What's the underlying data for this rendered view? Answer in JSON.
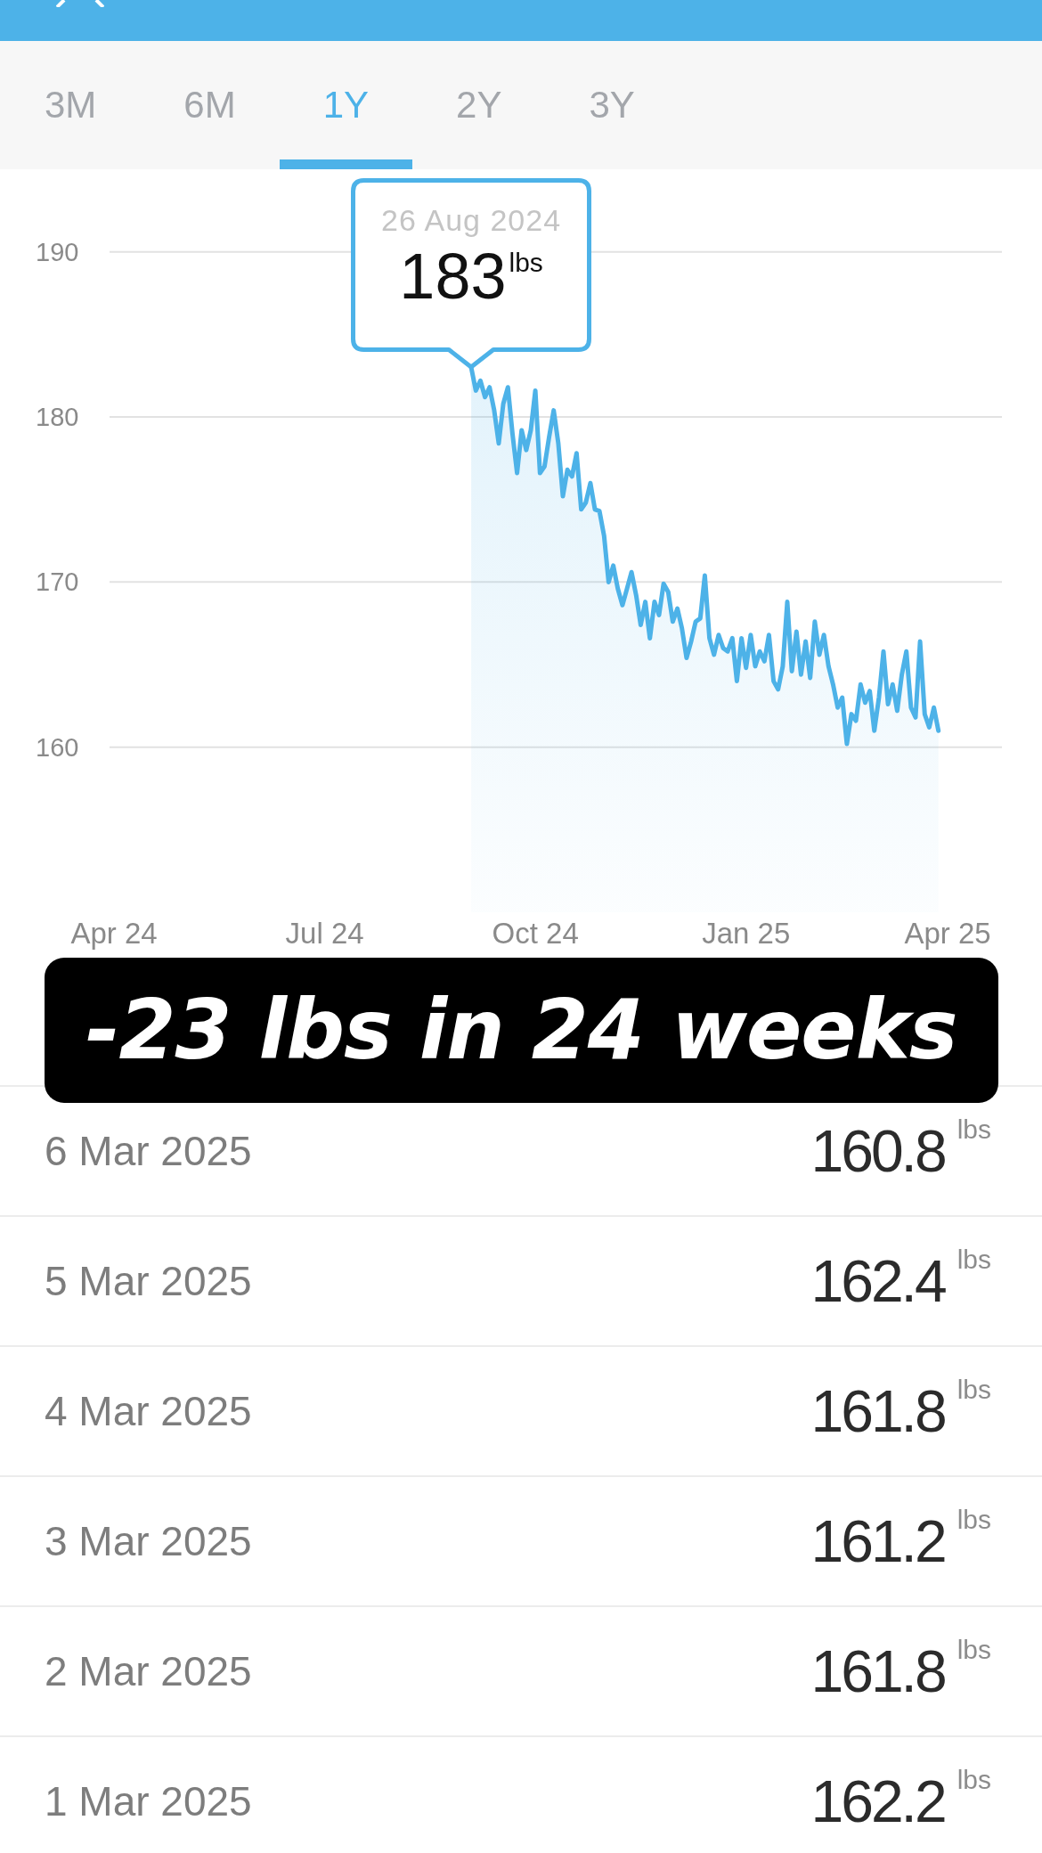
{
  "tabs": [
    {
      "label": "3M",
      "selected": false
    },
    {
      "label": "6M",
      "selected": false
    },
    {
      "label": "1Y",
      "selected": true
    },
    {
      "label": "2Y",
      "selected": false
    },
    {
      "label": "3Y",
      "selected": false
    }
  ],
  "chart": {
    "tooltip": {
      "date": "26 Aug 2024",
      "value": "183",
      "unit": "lbs"
    },
    "chart_data": {
      "type": "area",
      "grid": true,
      "ylim": [
        160,
        190
      ],
      "yticks": [
        160,
        170,
        180,
        190
      ],
      "categories": [
        "Apr 24",
        null,
        null,
        null,
        null,
        null,
        null,
        null,
        null,
        null,
        null,
        null,
        null,
        null,
        null,
        null,
        null,
        null,
        null,
        null,
        null,
        null,
        null,
        null,
        null,
        null,
        null,
        null,
        null,
        null,
        null,
        null,
        null,
        null,
        null,
        null,
        null,
        null,
        null,
        null,
        null,
        null,
        null,
        null,
        null,
        null,
        "Jul 24",
        null,
        null,
        null,
        null,
        null,
        null,
        null,
        null,
        null,
        null,
        null,
        null,
        null,
        null,
        null,
        null,
        null,
        null,
        null,
        null,
        null,
        null,
        null,
        null,
        null,
        null,
        null,
        null,
        null,
        null,
        null,
        null,
        null,
        null,
        null,
        null,
        null,
        null,
        null,
        null,
        null,
        null,
        null,
        null,
        null,
        "Oct 24",
        null,
        null,
        null,
        null,
        null,
        null,
        null,
        null,
        null,
        null,
        null,
        null,
        null,
        null,
        null,
        null,
        null,
        null,
        null,
        null,
        null,
        null,
        null,
        null,
        null,
        null,
        null,
        null,
        null,
        null,
        null,
        null,
        null,
        null,
        null,
        null,
        null,
        null,
        null,
        null,
        null,
        null,
        null,
        null,
        null,
        "Jan 25",
        null,
        null,
        null,
        null,
        null,
        null,
        null,
        null,
        null,
        null,
        null,
        null,
        null,
        null,
        null,
        null,
        null,
        null,
        null,
        null,
        null,
        null,
        null,
        null,
        null,
        null,
        null,
        null,
        null,
        null,
        null,
        null,
        null,
        null,
        null,
        null,
        null,
        null,
        null,
        null,
        null,
        null,
        null,
        "Apr 25"
      ],
      "values": [
        null,
        null,
        null,
        null,
        null,
        null,
        null,
        null,
        null,
        null,
        null,
        null,
        null,
        null,
        null,
        null,
        null,
        null,
        null,
        null,
        null,
        null,
        null,
        null,
        null,
        null,
        null,
        null,
        null,
        null,
        null,
        null,
        null,
        null,
        null,
        null,
        null,
        null,
        null,
        null,
        null,
        null,
        null,
        null,
        null,
        null,
        null,
        null,
        null,
        null,
        null,
        null,
        null,
        null,
        null,
        null,
        null,
        null,
        null,
        null,
        null,
        null,
        null,
        null,
        null,
        null,
        null,
        null,
        null,
        null,
        null,
        null,
        null,
        null,
        null,
        null,
        null,
        null,
        183.0,
        181.6,
        182.2,
        181.2,
        181.8,
        180.4,
        178.4,
        180.8,
        181.8,
        179.0,
        176.6,
        179.2,
        178.0,
        179.2,
        181.6,
        176.6,
        177.0,
        178.8,
        180.4,
        178.4,
        175.2,
        176.8,
        176.4,
        177.8,
        174.4,
        174.8,
        176.0,
        174.4,
        174.3,
        172.8,
        170.0,
        171.0,
        169.6,
        168.6,
        169.6,
        170.6,
        169.2,
        167.4,
        168.8,
        166.6,
        168.8,
        168.0,
        169.9,
        169.4,
        167.6,
        168.4,
        167.2,
        165.4,
        166.4,
        167.6,
        167.8,
        170.4,
        166.6,
        165.6,
        166.8,
        166.0,
        165.8,
        166.6,
        164.0,
        166.6,
        164.8,
        166.8,
        164.9,
        165.8,
        165.2,
        166.8,
        164.0,
        163.5,
        164.9,
        168.8,
        164.6,
        167.0,
        164.4,
        166.4,
        164.2,
        167.6,
        165.6,
        166.8,
        164.9,
        163.8,
        162.4,
        163.0,
        160.2,
        162.0,
        161.6,
        163.8,
        162.7,
        163.4,
        161.0,
        163.0,
        165.8,
        162.6,
        163.8,
        162.2,
        164.4,
        165.8,
        162.4,
        161.8,
        166.4,
        162.0,
        161.2,
        162.4,
        161.0,
        null,
        null
      ]
    }
  },
  "banner": {
    "text": "-23 lbs in 24 weeks"
  },
  "entries": [
    {
      "date": "6 Mar 2025",
      "value": "160.8",
      "unit": "lbs"
    },
    {
      "date": "5 Mar 2025",
      "value": "162.4",
      "unit": "lbs"
    },
    {
      "date": "4 Mar 2025",
      "value": "161.8",
      "unit": "lbs"
    },
    {
      "date": "3 Mar 2025",
      "value": "161.2",
      "unit": "lbs"
    },
    {
      "date": "2 Mar 2025",
      "value": "161.8",
      "unit": "lbs"
    },
    {
      "date": "1 Mar 2025",
      "value": "162.2",
      "unit": "lbs"
    }
  ]
}
